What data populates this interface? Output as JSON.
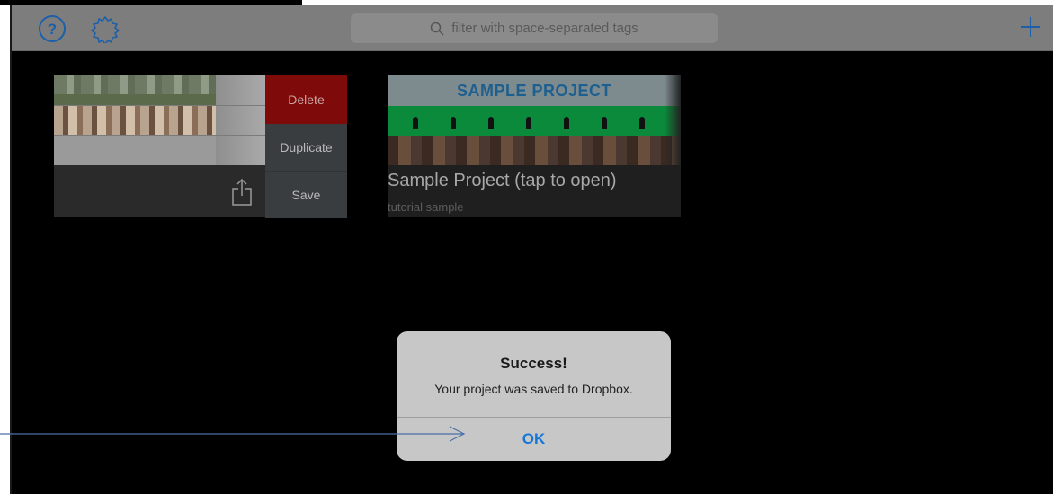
{
  "navbar": {
    "search_placeholder": "filter with space-separated tags",
    "colors": {
      "accent": "#1577d8"
    }
  },
  "projects": [
    {
      "actions": {
        "delete_label": "Delete",
        "duplicate_label": "Duplicate",
        "save_label": "Save"
      }
    },
    {
      "thumbnail_title": "SAMPLE PROJECT",
      "name": "Sample Project (tap to open)",
      "tag": "tutorial sample"
    }
  ],
  "alert": {
    "title": "Success!",
    "message": "Your project was saved to Dropbox.",
    "ok_label": "OK"
  },
  "icons": [
    "help-icon",
    "gear-icon",
    "search-icon",
    "plus-icon",
    "share-icon",
    "annotation-arrow"
  ]
}
